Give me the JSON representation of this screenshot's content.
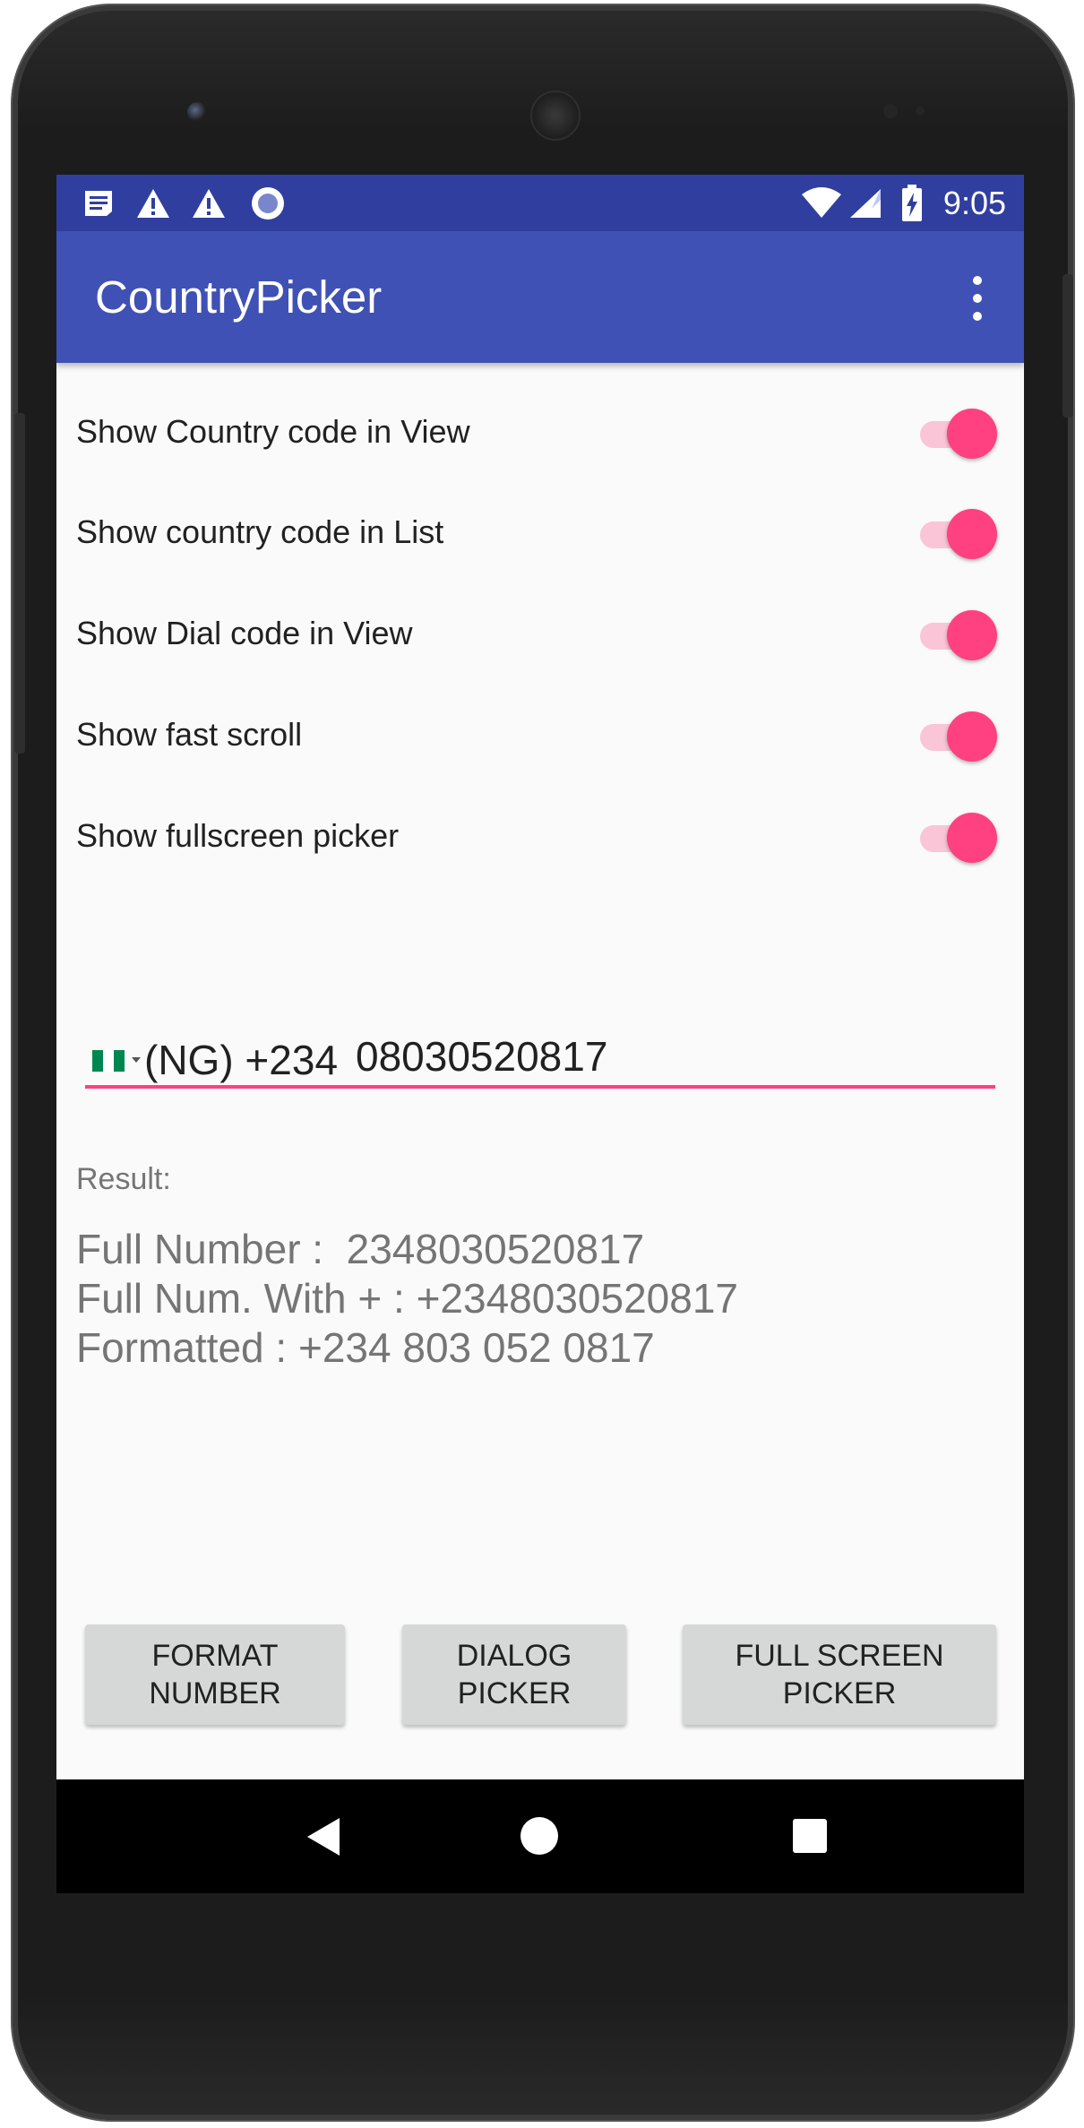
{
  "status_bar": {
    "time": "9:05",
    "left_icons": [
      "notification-icon",
      "warning-icon",
      "warning-icon",
      "record-icon"
    ],
    "right_icons": [
      "wifi-icon",
      "signal-icon",
      "battery-charging-icon"
    ]
  },
  "app_bar": {
    "title": "CountryPicker",
    "menu_icon": "overflow-menu-icon"
  },
  "switches": [
    {
      "label": "Show Country code in View",
      "checked": true
    },
    {
      "label": "Show country code in List",
      "checked": true
    },
    {
      "label": "Show Dial code in View",
      "checked": true
    },
    {
      "label": "Show fast scroll",
      "checked": true
    },
    {
      "label": "Show fullscreen picker",
      "checked": true
    }
  ],
  "phone_input": {
    "country_flag": "nigeria-flag-icon",
    "country_code_display": "(NG) +234",
    "value": "08030520817"
  },
  "result": {
    "label": "Result:",
    "full_number": "Full Number :  2348030520817",
    "full_number_plus": "Full Num. With + : +2348030520817",
    "formatted": "Formatted : +234 803 052 0817"
  },
  "buttons": {
    "format_line1": "FORMAT",
    "format_line2": "NUMBER",
    "dialog_line1": "DIALOG",
    "dialog_line2": "PICKER",
    "fullscreen_line1": "FULL SCREEN",
    "fullscreen_line2": "PICKER"
  },
  "nav_bar": {
    "icons": [
      "back-icon",
      "home-icon",
      "recent-apps-icon"
    ]
  },
  "colors": {
    "status_bar": "#303f9f",
    "app_bar": "#3f51b5",
    "accent": "#ff4081",
    "button_bg": "#d6d7d7"
  }
}
